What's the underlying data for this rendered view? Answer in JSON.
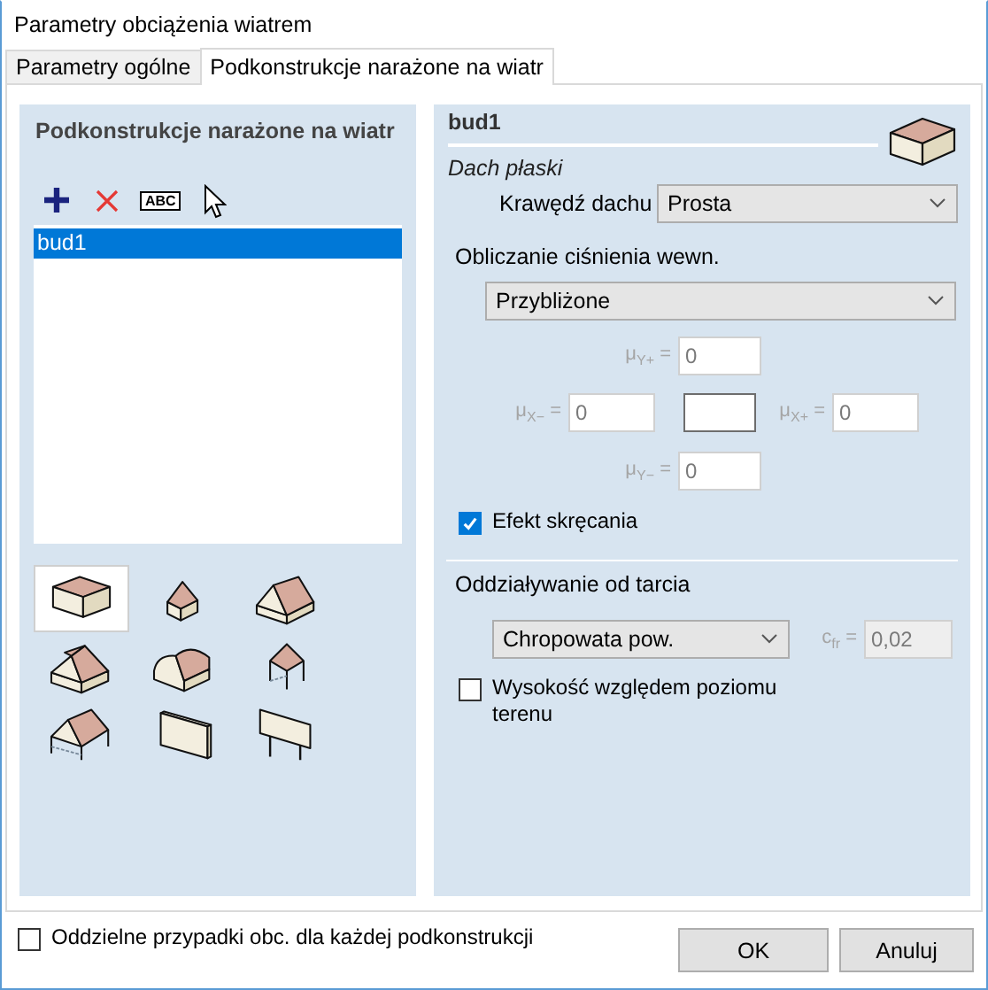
{
  "window": {
    "title": "Parametry obciążenia wiatrem"
  },
  "tabs": [
    {
      "label": "Parametry ogólne",
      "selected": false
    },
    {
      "label": "Podkonstrukcje narażone na wiatr",
      "selected": true
    }
  ],
  "structures_panel": {
    "heading": "Podkonstrukcje narażone na wiatr",
    "toolbar": [
      {
        "kind": "add"
      },
      {
        "kind": "delete"
      },
      {
        "kind": "rename",
        "text": "ABC"
      }
    ],
    "items": [
      {
        "label": "bud1",
        "selected": true
      }
    ],
    "building_types": [
      {
        "kind": "flat",
        "selected": true
      },
      {
        "kind": "pyramid",
        "selected": false
      },
      {
        "kind": "gable",
        "selected": false
      },
      {
        "kind": "hip",
        "selected": false
      },
      {
        "kind": "barrel",
        "selected": false
      },
      {
        "kind": "canopy",
        "selected": false
      },
      {
        "kind": "gable-canopy",
        "selected": false
      },
      {
        "kind": "wall",
        "selected": false
      },
      {
        "kind": "sign",
        "selected": false
      }
    ]
  },
  "details": {
    "name": "bud1",
    "roof_type": "Dach płaski",
    "roof_edge": {
      "label": "Krawędź dachu",
      "value": "Prosta"
    },
    "internal_pressure": {
      "label": "Obliczanie ciśnienia wewn.",
      "value": "Przybliżone",
      "coefficients": [
        {
          "kind": "top",
          "label": "μ$_{Y+}$ =",
          "value": "0",
          "disabled": true
        },
        {
          "kind": "left",
          "label": "μ$_{X−}$ =",
          "value": "0",
          "disabled": true
        },
        {
          "kind": "right",
          "label": "μ$_{X+}$ =",
          "value": "0",
          "disabled": true
        },
        {
          "kind": "bottom",
          "label": "μ$_{Y−}$ =",
          "value": "0",
          "disabled": true
        }
      ]
    },
    "torsion": {
      "label": "Efekt skręcania",
      "checked": true
    },
    "friction": {
      "label": "Oddziaływanie od tarcia",
      "value": "Chropowata pow.",
      "coefficient": {
        "label": "c$_{fr}$ =",
        "value": "0,02",
        "disabled": true
      }
    },
    "height_above_ground": {
      "label": "Wysokość względem poziomu terenu",
      "checked": false
    }
  },
  "separate_cases": {
    "label": "Oddzielne przypadki obc. dla każdej podkonstrukcji",
    "checked": false
  },
  "buttons": [
    {
      "label": "OK"
    },
    {
      "label": "Anuluj"
    }
  ]
}
